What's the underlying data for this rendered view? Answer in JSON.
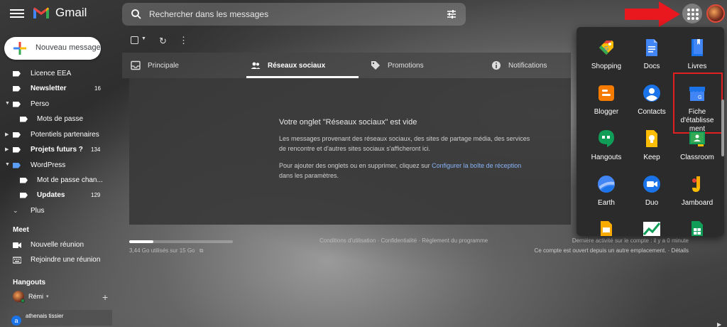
{
  "header": {
    "app_name": "Gmail",
    "search_placeholder": "Rechercher dans les messages"
  },
  "compose": {
    "label": "Nouveau message"
  },
  "sidebar": {
    "items": [
      {
        "label": "Licence EEA",
        "count": "",
        "bold": false
      },
      {
        "label": "Newsletter",
        "count": "16",
        "bold": true
      },
      {
        "label": "Perso",
        "count": "",
        "bold": false
      },
      {
        "label": "Mots de passe",
        "count": "",
        "bold": false
      },
      {
        "label": "Potentiels partenaires",
        "count": "",
        "bold": false
      },
      {
        "label": "Projets futurs ?",
        "count": "134",
        "bold": true
      },
      {
        "label": "WordPress",
        "count": "",
        "bold": false
      },
      {
        "label": "Mot de passe chan...",
        "count": "",
        "bold": false
      },
      {
        "label": "Updates",
        "count": "129",
        "bold": true
      },
      {
        "label": "Plus",
        "count": "",
        "bold": false
      }
    ]
  },
  "meet": {
    "title": "Meet",
    "new_meeting": "Nouvelle réunion",
    "join_meeting": "Rejoindre une réunion"
  },
  "hangouts": {
    "title": "Hangouts",
    "user": "Rémi",
    "contact": "athenais tissier",
    "contact_initial": "a"
  },
  "tabs": [
    {
      "label": "Principale",
      "active": false
    },
    {
      "label": "Réseaux sociaux",
      "active": true
    },
    {
      "label": "Promotions",
      "active": false
    },
    {
      "label": "Notifications",
      "active": false
    }
  ],
  "empty_state": {
    "title": "Votre onglet \"Réseaux sociaux\" est vide",
    "line1": "Les messages provenant des réseaux sociaux, des sites de partage média, des services",
    "line2": "de rencontre et d'autres sites sociaux s'afficheront ici.",
    "line3_prefix": "Pour ajouter des onglets ou en supprimer, cliquez sur ",
    "line3_link": "Configurer la boîte de réception",
    "line4": "dans les paramètres."
  },
  "footer": {
    "storage_used": "3,44 Go utilisés sur 15 Go",
    "storage_fraction": 0.23,
    "links": "Conditions d'utilisation · Confidentialité · Règlement du programme",
    "last_activity": "Dernière activité sur le compte : il y a 0 minute",
    "other_location": "Ce compte est ouvert depuis un autre emplacement. · Détails"
  },
  "apps": [
    {
      "label": "Shopping",
      "icon": "shopping-icon",
      "color": "#4285f4"
    },
    {
      "label": "Docs",
      "icon": "docs-icon",
      "color": "#4285f4"
    },
    {
      "label": "Livres",
      "icon": "books-icon",
      "color": "#1a73e8"
    },
    {
      "label": "Blogger",
      "icon": "blogger-icon",
      "color": "#f57c00"
    },
    {
      "label": "Contacts",
      "icon": "contacts-icon",
      "color": "#1a73e8"
    },
    {
      "label": "Fiche d'établisse ment",
      "icon": "business-profile-icon",
      "color": "#4285f4"
    },
    {
      "label": "Hangouts",
      "icon": "hangouts-icon",
      "color": "#0f9d58"
    },
    {
      "label": "Keep",
      "icon": "keep-icon",
      "color": "#fbbc04"
    },
    {
      "label": "Classroom",
      "icon": "classroom-icon",
      "color": "#0f9d58"
    },
    {
      "label": "Earth",
      "icon": "earth-icon",
      "color": "#4285f4"
    },
    {
      "label": "Duo",
      "icon": "duo-icon",
      "color": "#1a73e8"
    },
    {
      "label": "Jamboard",
      "icon": "jamboard-icon",
      "color": "#f9ab00"
    },
    {
      "label": "",
      "icon": "slides-like-icon",
      "color": "#f9ab00"
    },
    {
      "label": "",
      "icon": "chart-app-icon",
      "color": "#0f9d58"
    },
    {
      "label": "",
      "icon": "sheets-icon",
      "color": "#0f9d58"
    }
  ]
}
